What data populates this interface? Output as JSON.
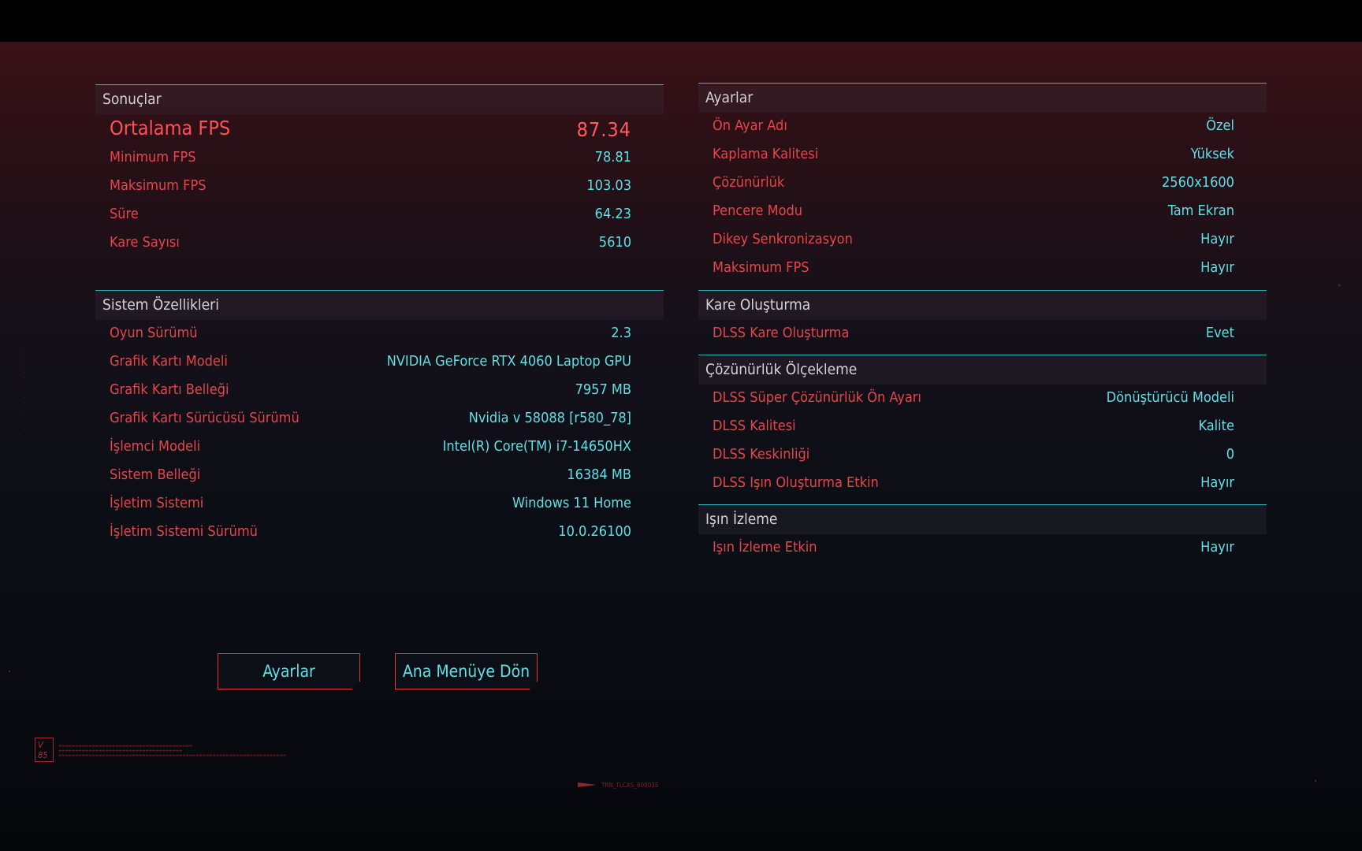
{
  "results": {
    "header": "Sonuçlar",
    "rows": [
      {
        "label": "Ortalama FPS",
        "value": "87.34"
      },
      {
        "label": "Minimum FPS",
        "value": "78.81"
      },
      {
        "label": "Maksimum FPS",
        "value": "103.03"
      },
      {
        "label": "Süre",
        "value": "64.23"
      },
      {
        "label": "Kare Sayısı",
        "value": "5610"
      }
    ]
  },
  "system": {
    "header": "Sistem Özellikleri",
    "rows": [
      {
        "label": "Oyun Sürümü",
        "value": "2.3"
      },
      {
        "label": "Grafik Kartı Modeli",
        "value": "NVIDIA GeForce RTX 4060 Laptop GPU"
      },
      {
        "label": "Grafik Kartı Belleği",
        "value": "7957 MB"
      },
      {
        "label": "Grafik Kartı Sürücüsü Sürümü",
        "value": "Nvidia v 58088 [r580_78]"
      },
      {
        "label": "İşlemci Modeli",
        "value": "Intel(R) Core(TM) i7-14650HX"
      },
      {
        "label": "Sistem Belleği",
        "value": "16384 MB"
      },
      {
        "label": "İşletim Sistemi",
        "value": "Windows 11 Home"
      },
      {
        "label": "İşletim Sistemi Sürümü",
        "value": "10.0.26100"
      }
    ]
  },
  "settings": {
    "header": "Ayarlar",
    "rows": [
      {
        "label": "Ön Ayar Adı",
        "value": "Özel"
      },
      {
        "label": "Kaplama Kalitesi",
        "value": "Yüksek"
      },
      {
        "label": "Çözünürlük",
        "value": "2560x1600"
      },
      {
        "label": "Pencere Modu",
        "value": "Tam Ekran"
      },
      {
        "label": "Dikey Senkronizasyon",
        "value": "Hayır"
      },
      {
        "label": "Maksimum FPS",
        "value": "Hayır"
      }
    ]
  },
  "frame_gen": {
    "header": "Kare Oluşturma",
    "rows": [
      {
        "label": "DLSS Kare Oluşturma",
        "value": "Evet"
      }
    ]
  },
  "scaling": {
    "header": "Çözünürlük Ölçekleme",
    "rows": [
      {
        "label": "DLSS Süper Çözünürlük Ön Ayarı",
        "value": "Dönüştürücü Modeli"
      },
      {
        "label": "DLSS Kalitesi",
        "value": "Kalite"
      },
      {
        "label": "DLSS Keskinliği",
        "value": "0"
      },
      {
        "label": "DLSS Işın Oluşturma Etkin",
        "value": "Hayır"
      }
    ]
  },
  "raytracing": {
    "header": "Işın İzleme",
    "rows": [
      {
        "label": "Işın İzleme Etkin",
        "value": "Hayır"
      }
    ]
  },
  "buttons": {
    "settings": "Ayarlar",
    "main_menu": "Ana Menüye Dön"
  },
  "decor": {
    "badge": "V 85",
    "footer_code": "TRN_TLCAS_800035"
  },
  "colors": {
    "label_red": "#e5464a",
    "value_cyan": "#5ee0e6",
    "divider_teal": "#2fb5be",
    "background_top": "#3a1117",
    "background_bottom": "#06070b"
  }
}
